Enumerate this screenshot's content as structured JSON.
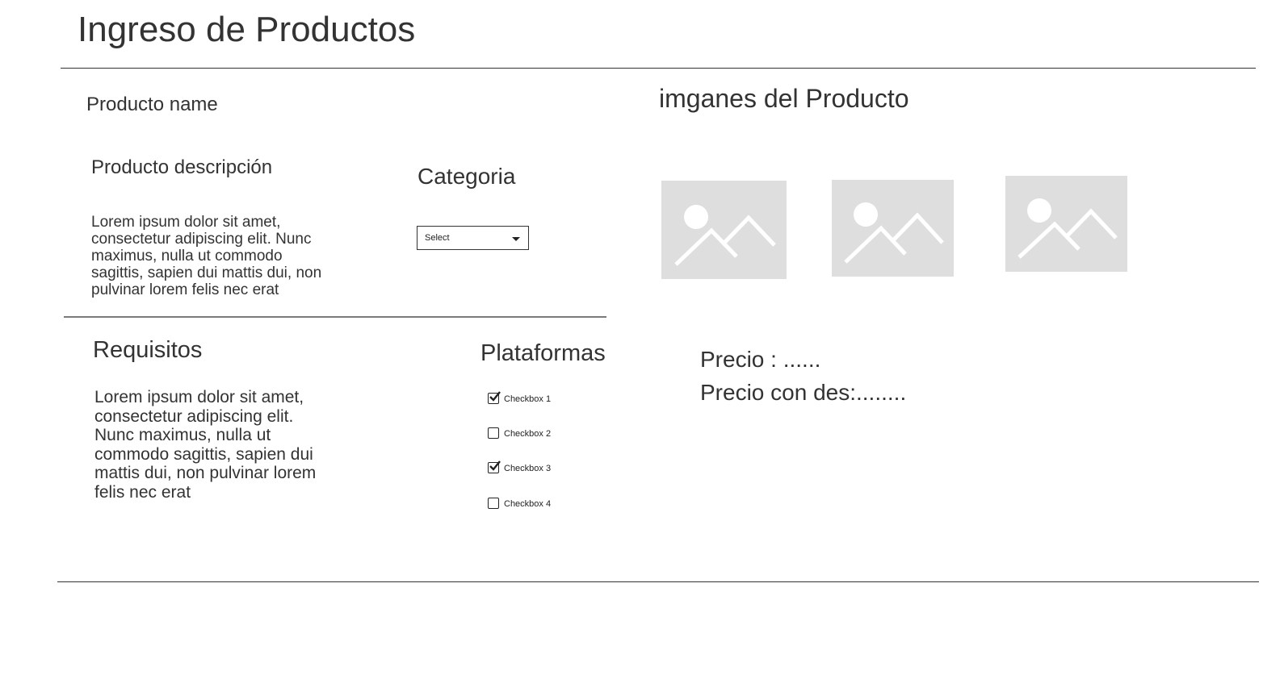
{
  "header": {
    "title": "Ingreso de Productos"
  },
  "product": {
    "name_label": "Producto name",
    "description_label": "Producto descripción",
    "description_text": "Lorem ipsum dolor sit amet, consectetur adipiscing elit. Nunc maximus, nulla ut commodo sagittis, sapien dui mattis dui, non pulvinar lorem felis nec erat"
  },
  "category": {
    "label": "Categoria",
    "selected": "Select"
  },
  "requirements": {
    "label": "Requisitos",
    "text": "Lorem ipsum dolor sit amet, consectetur adipiscing elit. Nunc maximus, nulla ut commodo sagittis, sapien dui mattis dui, non pulvinar lorem felis nec erat"
  },
  "platforms": {
    "label": "Plataformas",
    "checkboxes": [
      {
        "label": "Checkbox 1",
        "checked": true
      },
      {
        "label": "Checkbox 2",
        "checked": false
      },
      {
        "label": "Checkbox 3",
        "checked": true
      },
      {
        "label": "Checkbox 4",
        "checked": false
      }
    ]
  },
  "images": {
    "label": "imganes del Producto"
  },
  "pricing": {
    "price": "Precio : ......",
    "discount_price": "Precio con des:........"
  },
  "colors": {
    "text": "#333333",
    "placeholder_bg": "#dedede",
    "placeholder_fg": "#ffffff"
  }
}
